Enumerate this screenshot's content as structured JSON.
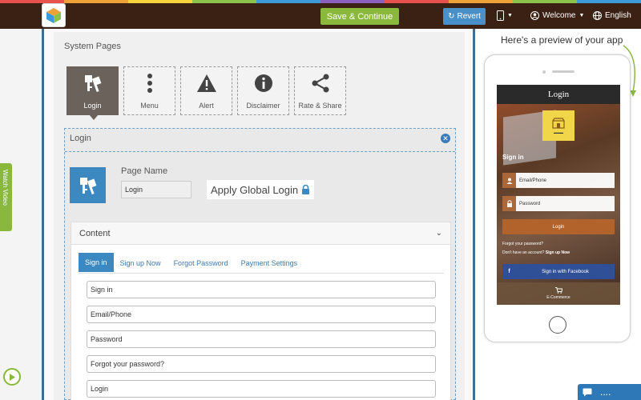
{
  "colors": {
    "stripe": [
      "#e8524c",
      "#f0a23a",
      "#f7d33c",
      "#8ac34a",
      "#3b9ad8",
      "#8b5fbf",
      "#e8524c",
      "#f0a23a",
      "#8ac34a",
      "#3b9ad8"
    ],
    "topbar": "#3a2113",
    "save_button": "#8ab83d",
    "revert_button": "#4a90c8",
    "accent_blue": "#3c88c0"
  },
  "topbar": {
    "save_label": "Save & Continue",
    "revert_label": "Revert",
    "welcome_label": "Welcome",
    "language_label": "English"
  },
  "system_pages": {
    "title": "System Pages",
    "tiles": [
      {
        "label": "Login",
        "icon": "login-keys-icon",
        "active": true
      },
      {
        "label": "Menu",
        "icon": "vertical-dots-icon",
        "active": false
      },
      {
        "label": "Alert",
        "icon": "warning-icon",
        "active": false
      },
      {
        "label": "Disclaimer",
        "icon": "info-icon",
        "active": false
      },
      {
        "label": "Rate & Share",
        "icon": "share-icon",
        "active": false
      }
    ]
  },
  "login_section": {
    "title": "Login",
    "page_name_label": "Page Name",
    "page_name_value": "Login",
    "apply_global_label": "Apply Global Login"
  },
  "content": {
    "title": "Content",
    "tabs": [
      "Sign in",
      "Sign up Now",
      "Forgot Password",
      "Payment Settings"
    ],
    "active_tab": "Sign in",
    "fields": [
      "Sign in",
      "Email/Phone",
      "Password",
      "Forgot your password?",
      "Login"
    ]
  },
  "watch_video_label": "Watch Video",
  "preview": {
    "title": "Here's a preview of your app",
    "screen_title": "Login",
    "signin": "Sign in",
    "email_placeholder": "Email/Phone",
    "password_placeholder": "Password",
    "login_button": "Login",
    "forgot": "Forgot your password?",
    "no_account": "Don't have an account?",
    "sign_up": "Sign up Now",
    "facebook_button": "Sign in with Facebook",
    "bottom_label": "E-Commerce"
  },
  "chat": {
    "dots": "...."
  }
}
